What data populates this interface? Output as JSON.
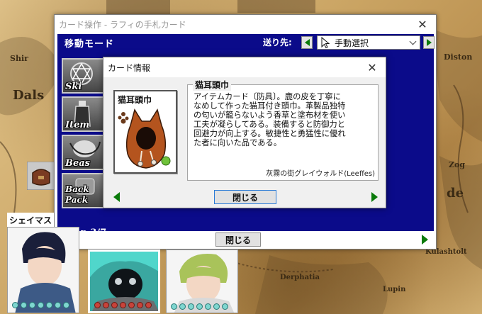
{
  "map": {
    "labels": [
      "Shir",
      "Dals",
      "Diston",
      "Zog",
      "de",
      "Kulashtolt",
      "Derphatia",
      "Lupin"
    ]
  },
  "outer_window": {
    "title": "カード操作 - ラフィの手札カード",
    "mode_title": "移動モード",
    "dest_label": "送り先:",
    "dest_selected": "手動選択",
    "categories": [
      "Ski",
      "Item",
      "Beas",
      "Back Pack"
    ],
    "capacity": "Cap 3/7",
    "close_label": "閉じる",
    "icons": [
      "close-icon",
      "arrow-left-icon",
      "arrow-right-icon",
      "pointer-icon",
      "chevron-down-icon"
    ]
  },
  "card_dialog": {
    "title": "カード情報",
    "card_name": "猫耳頭巾",
    "description_title": "猫耳頭巾",
    "description": "アイテムカード〔防具〕。鹿の皮を丁寧に\nなめして作った猫耳付き頭巾。革製品独特\nの匂いが籠らないよう香草と塗布材を使い\n工夫が凝らしてある。装備すると防御力と\n回避力が向上する。敏捷性と勇猛性に優れ\nた者に向いた品である。",
    "source": "灰霧の街グレイウォルド(Leeffes)",
    "close_label": "閉じる"
  },
  "party": {
    "name": "シェイマス",
    "colors": {
      "dialog_blue": "#0b0b8a",
      "nav_green": "#0a7a0a",
      "dot_teal": "#7fd6d0",
      "dot_red": "#c8433a"
    }
  }
}
